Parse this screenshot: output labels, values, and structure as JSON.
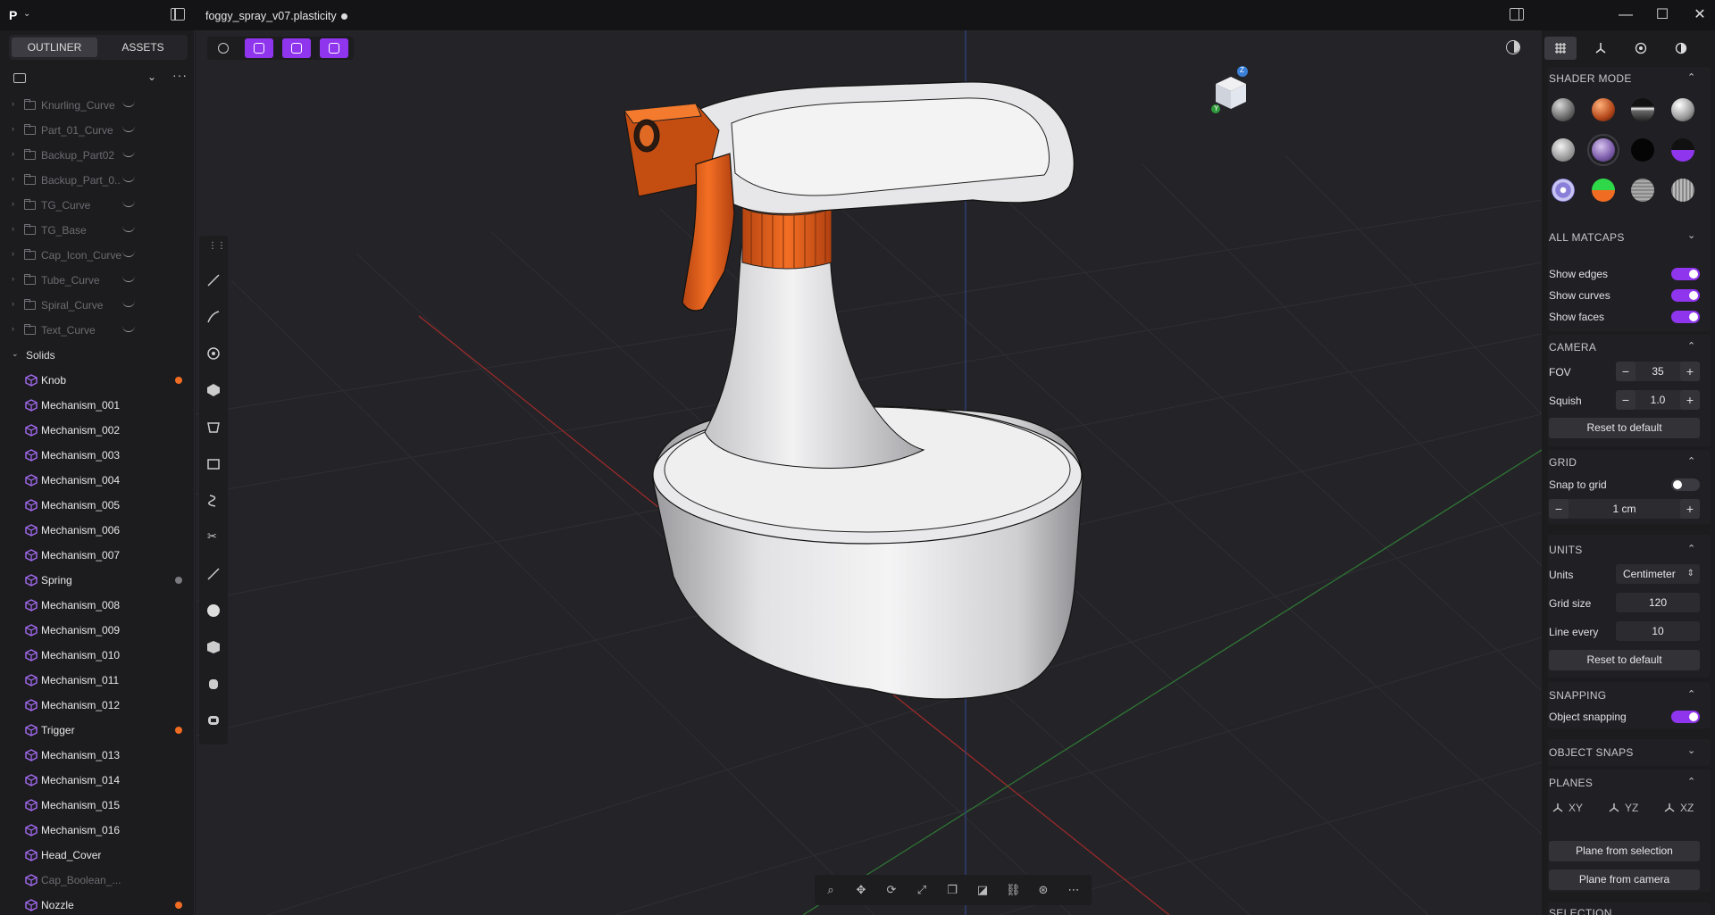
{
  "app": {
    "logo": "P",
    "document_title": "foggy_spray_v07.plasticity"
  },
  "window_controls": {
    "minimize": "—",
    "maximize": "☐",
    "close": "✕"
  },
  "left_panel": {
    "tabs": [
      {
        "label": "OUTLINER",
        "active": true
      },
      {
        "label": "ASSETS",
        "active": false
      }
    ],
    "curves": [
      "Knurling_Curve",
      "Part_01_Curve",
      "Backup_Part02",
      "Backup_Part_0...",
      "TG_Curve",
      "TG_Base",
      "Cap_Icon_Curve",
      "Tube_Curve",
      "Spiral_Curve",
      "Text_Curve"
    ],
    "solids_section": "Solids",
    "solids": [
      {
        "label": "Knob",
        "mark": "orange"
      },
      {
        "label": "Mechanism_001",
        "mark": ""
      },
      {
        "label": "Mechanism_002",
        "mark": ""
      },
      {
        "label": "Mechanism_003",
        "mark": ""
      },
      {
        "label": "Mechanism_004",
        "mark": ""
      },
      {
        "label": "Mechanism_005",
        "mark": ""
      },
      {
        "label": "Mechanism_006",
        "mark": ""
      },
      {
        "label": "Mechanism_007",
        "mark": ""
      },
      {
        "label": "Spring",
        "mark": "gray"
      },
      {
        "label": "Mechanism_008",
        "mark": ""
      },
      {
        "label": "Mechanism_009",
        "mark": ""
      },
      {
        "label": "Mechanism_010",
        "mark": ""
      },
      {
        "label": "Mechanism_011",
        "mark": ""
      },
      {
        "label": "Mechanism_012",
        "mark": ""
      },
      {
        "label": "Trigger",
        "mark": "orange"
      },
      {
        "label": "Mechanism_013",
        "mark": ""
      },
      {
        "label": "Mechanism_014",
        "mark": ""
      },
      {
        "label": "Mechanism_015",
        "mark": ""
      },
      {
        "label": "Mechanism_016",
        "mark": ""
      },
      {
        "label": "Head_Cover",
        "mark": ""
      },
      {
        "label": "Cap_Boolean_...",
        "mark": "",
        "dim": true
      },
      {
        "label": "Nozzle",
        "mark": "orange"
      }
    ]
  },
  "viewport": {
    "view_cube_axis_z": "Z",
    "view_cube_axis_y": "Y"
  },
  "right_panel": {
    "shader_mode": {
      "title": "SHADER MODE"
    },
    "all_matcaps": "ALL MATCAPS",
    "show_edges": {
      "label": "Show edges",
      "on": true
    },
    "show_curves": {
      "label": "Show curves",
      "on": true
    },
    "show_faces": {
      "label": "Show faces",
      "on": true
    },
    "camera": {
      "title": "CAMERA",
      "fov_label": "FOV",
      "fov": "35",
      "squish_label": "Squish",
      "squish": "1.0",
      "reset": "Reset to default"
    },
    "grid": {
      "title": "GRID",
      "snap_label": "Snap to grid",
      "snap_on": false,
      "size": "1 cm"
    },
    "units": {
      "title": "UNITS",
      "units_label": "Units",
      "units_value": "Centimeter",
      "grid_size_label": "Grid size",
      "grid_size": "120",
      "line_every_label": "Line every",
      "line_every": "10",
      "reset": "Reset to default"
    },
    "snapping": {
      "title": "SNAPPING",
      "object_label": "Object snapping",
      "object_on": true
    },
    "object_snaps": "OBJECT SNAPS",
    "planes": {
      "title": "PLANES",
      "xy": "XY",
      "yz": "YZ",
      "xz": "XZ",
      "from_selection": "Plane from selection",
      "from_camera": "Plane from camera"
    },
    "selection": "SELECTION"
  },
  "colors": {
    "accent": "#8f35ee",
    "orange": "#f06c22",
    "bg": "#1c1c1f",
    "viewport": "#242428"
  }
}
